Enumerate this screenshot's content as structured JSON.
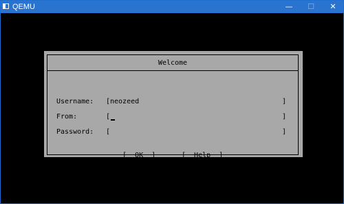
{
  "window": {
    "title": "QEMU",
    "controls": {
      "minimize": "—",
      "maximize": "☐",
      "close": "✕"
    },
    "colors": {
      "titlebar": "#2a73cf",
      "screen": "#000000",
      "dialog": "#a8a8a8"
    }
  },
  "dialog": {
    "title": "Welcome",
    "fields": {
      "username": {
        "label": "Username:",
        "value": "neozeed"
      },
      "from": {
        "label": "From:",
        "value": ""
      },
      "password": {
        "label": "Password:",
        "value": ""
      }
    },
    "buttons": {
      "ok": "[  OK  ]",
      "help": "[  Help  ]"
    }
  }
}
